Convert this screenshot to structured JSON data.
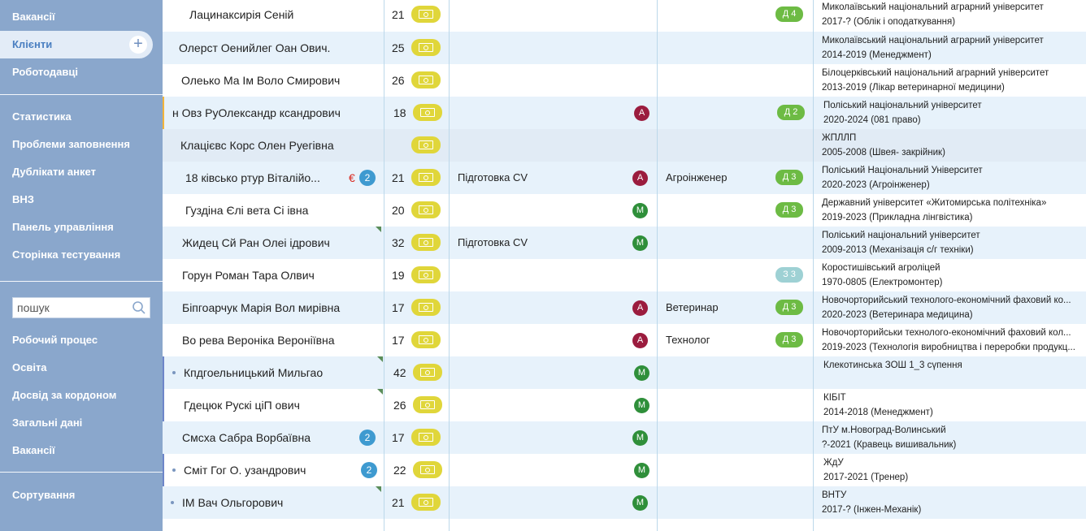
{
  "sidebar": {
    "top_items": [
      {
        "label": "Вакансії"
      },
      {
        "label": "Клієнти"
      },
      {
        "label": "Роботодавці"
      }
    ],
    "add_label": "+",
    "group2": [
      {
        "label": "Статистика"
      },
      {
        "label": "Проблеми заповнення"
      },
      {
        "label": "Дублікати анкет"
      },
      {
        "label": "ВНЗ"
      },
      {
        "label": "Панель управління"
      },
      {
        "label": "Сторінка тестування"
      }
    ],
    "search": {
      "placeholder": "пошук"
    },
    "group3": [
      {
        "label": "Робочий процес"
      },
      {
        "label": "Освіта"
      },
      {
        "label": "Досвід за кордоном"
      },
      {
        "label": "Загальні дані"
      },
      {
        "label": "Вакансії"
      }
    ],
    "sort_label": "Сортування"
  },
  "colors": {
    "sidebar": "#8aa7cc",
    "accent": "#4a7fc1",
    "card": "#e0d63a",
    "level": "#6dbb44",
    "letter_A": "#9b1c3e",
    "letter_M": "#2f8f3a"
  },
  "rows": [
    {
      "name": "Лацинаксирія Сеній",
      "age": "21",
      "stage": "",
      "letter": "",
      "profession": "",
      "level": "Д 4",
      "edu1": "Миколаївський національний аграрний університет",
      "edu2": "2017-? (Облік і оподаткування)"
    },
    {
      "name": "Олерст Оенийлег Оан Ович.",
      "age": "25",
      "stage": "",
      "letter": "",
      "profession": "",
      "level": "",
      "edu1": "Миколаївський національний аграрний університет",
      "edu2": "2014-2019 (Менеджмент)"
    },
    {
      "name": "Олеько Ма Ім Воло Смирович",
      "age": "26",
      "stage": "",
      "letter": "",
      "profession": "",
      "level": "",
      "edu1": "Білоцерківський національний аграрний університет",
      "edu2": "2013-2019 (Лікар ветеринарної медицини)"
    },
    {
      "name": "н Овз РуОлександр ксандрович",
      "age": "18",
      "stage": "",
      "letter": "А",
      "profession": "",
      "level": "Д 2",
      "edu1": "Поліський національний університет",
      "edu2": "2020-2024 (081 право)"
    },
    {
      "name": "Клацієвс Корс Олен Руегівна",
      "age": "",
      "stage": "",
      "letter": "",
      "profession": "",
      "level": "",
      "edu1": "ЖПЛЛП",
      "edu2": "2005-2008 (Швея- закрійник)"
    },
    {
      "name": "18 ківсько ртур Віталійо...",
      "age": "21",
      "stage": "Підготовка CV",
      "letter": "А",
      "profession": "Агроінженер",
      "level": "Д 3",
      "edu1": "Поліський Національний Університет",
      "edu2": "2020-2023 (Агроінженер)",
      "badge": "2",
      "euro": "€"
    },
    {
      "name": "Гуздіна Єлі вета Сі івна",
      "age": "20",
      "stage": "",
      "letter": "М",
      "profession": "",
      "level": "Д 3",
      "edu1": "Державний університет «Житомирська політехніка»",
      "edu2": "2019-2023 (Прикладна лінгвістика)"
    },
    {
      "name": "Жидец Сй Ран Олеі ідрович",
      "age": "32",
      "stage": "Підготовка CV",
      "letter": "М",
      "profession": "",
      "level": "",
      "edu1": "Поліський національний університет",
      "edu2": "2009-2013 (Механізація с/г техніки)",
      "flag": true
    },
    {
      "name": "Горун Роман Тара Олвич",
      "age": "19",
      "stage": "",
      "letter": "",
      "profession": "",
      "level": "З 3",
      "edu1": "Коростишівський агроліцей",
      "edu2": "1970-0805 (Електромонтер)"
    },
    {
      "name": "Біпгоарчук Марія Вол мирівна",
      "age": "17",
      "stage": "",
      "letter": "А",
      "profession": "Ветеринар",
      "level": "Д 3",
      "edu1": "Новочорторийський технолого-економічний фаховий ко...",
      "edu2": "2020-2023 (Ветеринара медицина)"
    },
    {
      "name": "Во рева Вероніка Вероніївна",
      "age": "17",
      "stage": "",
      "letter": "А",
      "profession": "Технолог",
      "level": "Д 3",
      "edu1": "Новочорторийськи технолого-економічний фаховий кол...",
      "edu2": "2019-2023 (Технологія виробництва і переробки продукц..."
    },
    {
      "name": "Кпдгоельницький Мильгао",
      "age": "42",
      "stage": "",
      "letter": "М",
      "profession": "",
      "level": "",
      "edu1": "Клекотинська ЗОШ 1_3 сүпення",
      "edu2": "",
      "flag": true,
      "bullet": true
    },
    {
      "name": "Гдецюк Рускі ціП ович",
      "age": "26",
      "stage": "",
      "letter": "М",
      "profession": "",
      "level": "",
      "edu1": "КІБІТ",
      "edu2": "2014-2018 (Менеджмент)",
      "flag": true
    },
    {
      "name": "Смсха Сабра Ворбаївна",
      "age": "17",
      "stage": "",
      "letter": "М",
      "profession": "",
      "level": "",
      "edu1": "ПтУ м.Новоград-Волинський",
      "edu2": "?-2021 (Кравець вишивальник)",
      "badge": "2"
    },
    {
      "name": "Сміт Гог О. узандрович",
      "age": "22",
      "stage": "",
      "letter": "М",
      "profession": "",
      "level": "",
      "edu1": "ЖдУ",
      "edu2": "2017-2021 (Тренер)",
      "badge": "2",
      "bullet": true
    },
    {
      "name": "ІМ Вач Ольгорович",
      "age": "21",
      "stage": "",
      "letter": "М",
      "profession": "",
      "level": "",
      "edu1": "ВНТУ",
      "edu2": "2017-? (Інжен-Механік)",
      "flag": true,
      "bullet": true
    }
  ]
}
